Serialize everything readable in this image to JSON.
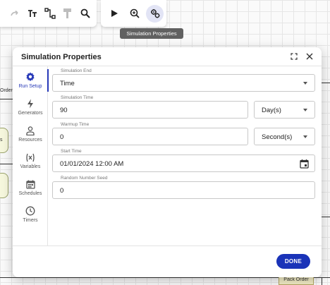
{
  "toolbar": {
    "items": [
      {
        "name": "redo-icon"
      },
      {
        "name": "text-format-icon"
      },
      {
        "name": "connector-icon"
      },
      {
        "name": "format-painter-icon"
      },
      {
        "name": "search-icon"
      }
    ],
    "secondary": [
      {
        "name": "play-icon"
      },
      {
        "name": "zoom-icon"
      },
      {
        "name": "simulation-settings-icon",
        "active": true
      }
    ],
    "tooltip": "Simulation Properties"
  },
  "background": {
    "order_label": "Order",
    "pack_order_label": "Pack Order",
    "node_stub_label": "s"
  },
  "dialog": {
    "title": "Simulation Properties",
    "done_label": "DONE",
    "nav": [
      {
        "label": "Run Setup",
        "icon": "gear-icon",
        "active": true
      },
      {
        "label": "Generators",
        "icon": "lightning-icon"
      },
      {
        "label": "Resources",
        "icon": "person-icon"
      },
      {
        "label": "Variables",
        "icon": "variable-icon"
      },
      {
        "label": "Schedules",
        "icon": "calendar-icon"
      },
      {
        "label": "Timers",
        "icon": "clock-icon"
      }
    ],
    "fields": {
      "simulation_end": {
        "label": "Simulation End",
        "value": "Time"
      },
      "simulation_time": {
        "label": "Simulation Time",
        "value": "90",
        "unit": "Day(s)"
      },
      "warmup_time": {
        "label": "Warmup Time",
        "value": "0",
        "unit": "Second(s)"
      },
      "start_time": {
        "label": "Start Time",
        "value": "01/01/2024 12:00 AM"
      },
      "random_seed": {
        "label": "Random Number Seed",
        "value": "0"
      }
    }
  },
  "colors": {
    "accent": "#1a33b8",
    "nav_active": "#2739b8"
  }
}
